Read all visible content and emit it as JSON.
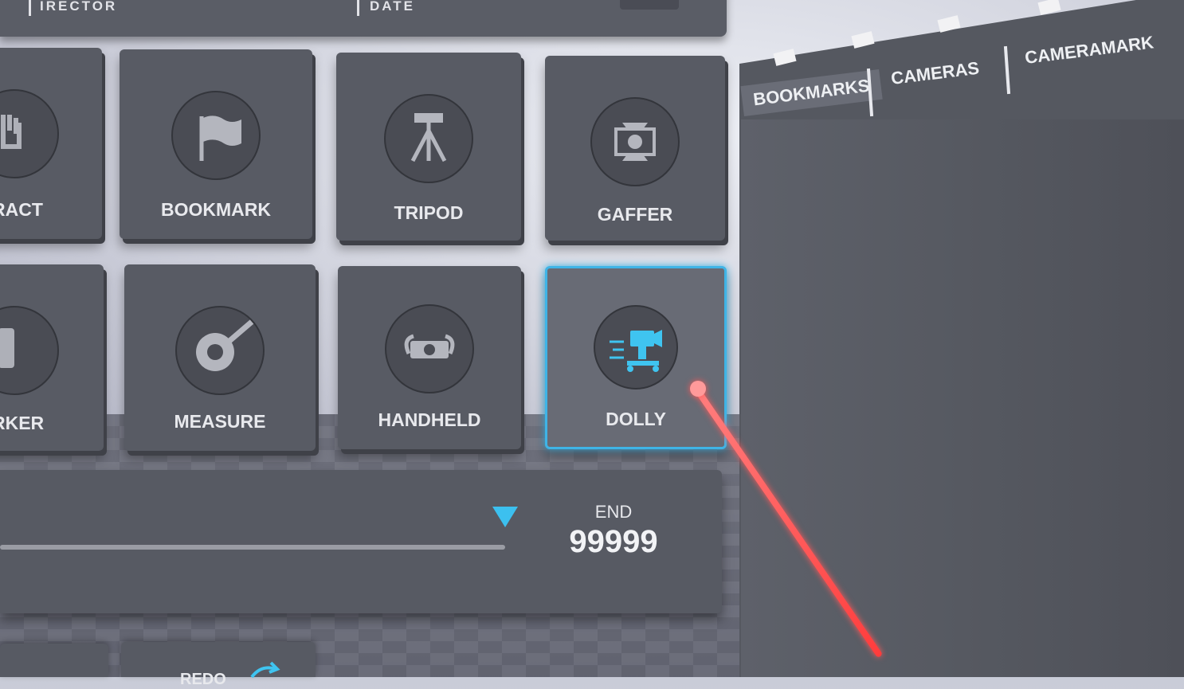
{
  "top_bar": {
    "left_label": "IRECTOR",
    "right_label": "DATE"
  },
  "tools": [
    {
      "label": "RACT",
      "icon": "hand-icon"
    },
    {
      "label": "BOOKMARK",
      "icon": "flag-icon"
    },
    {
      "label": "TRIPOD",
      "icon": "tripod-icon"
    },
    {
      "label": "GAFFER",
      "icon": "light-icon"
    },
    {
      "label": "RKER",
      "icon": "marker-icon"
    },
    {
      "label": "MEASURE",
      "icon": "tape-measure-icon"
    },
    {
      "label": "HANDHELD",
      "icon": "handheld-rig-icon"
    },
    {
      "label": "DOLLY",
      "icon": "dolly-camera-icon",
      "selected": true
    }
  ],
  "timeline": {
    "end_label": "END",
    "end_value": "99999"
  },
  "bottom": {
    "partial_label": "REDO"
  },
  "right_panel": {
    "tabs": [
      {
        "label": "BOOKMARKS",
        "active": true
      },
      {
        "label": "CAMERAS",
        "active": false
      },
      {
        "label": "CAMERAMARK",
        "active": false
      }
    ]
  },
  "colors": {
    "accent": "#3fb4e6",
    "laser": "#ff4a4a",
    "panel": "#585b64"
  }
}
